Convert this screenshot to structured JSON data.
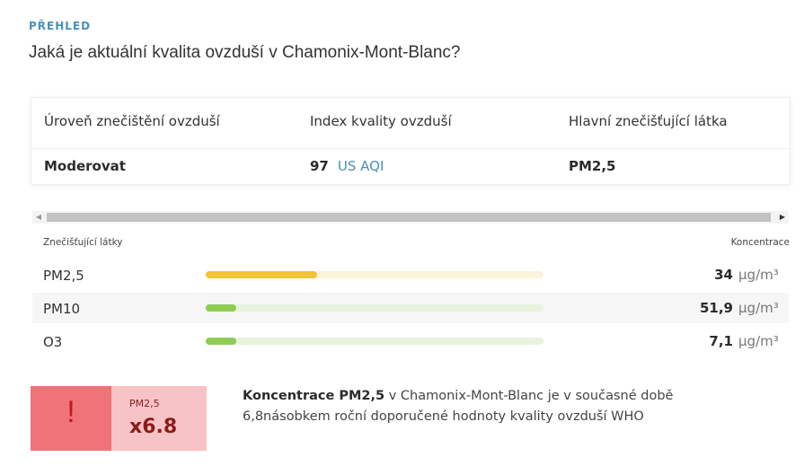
{
  "overview": {
    "section_label": "PŘEHLED",
    "question": "Jaká je aktuální kvalita ovzduší v Chamonix-Mont-Blanc?"
  },
  "summary": {
    "level_header": "Úroveň znečištění ovzduší",
    "level_value": "Moderovat",
    "aqi_header": "Index kvality ovzduší",
    "aqi_value": "97",
    "aqi_unit": "US AQI",
    "pollutant_header": "Hlavní znečišťující látka",
    "pollutant_value": "PM2,5"
  },
  "pollutants": {
    "header_left": "Znečišťující látky",
    "header_right": "Koncentrace",
    "rows": [
      {
        "name": "PM2,5",
        "value": "34",
        "unit": "µg/m³",
        "level": 0.33,
        "color": "#f2c335",
        "track": "#faf3d9"
      },
      {
        "name": "PM10",
        "value": "51,9",
        "unit": "µg/m³",
        "level": 0.09,
        "color": "#8fcc52",
        "track": "#e8f3dd"
      },
      {
        "name": "O3",
        "value": "7,1",
        "unit": "µg/m³",
        "level": 0.09,
        "color": "#8fcc52",
        "track": "#e8f3dd"
      }
    ]
  },
  "alert": {
    "icon": "exclamation-icon",
    "icon_glyph": "!",
    "label": "PM2,5",
    "multiplier": "x6.8",
    "text_bold": "Koncentrace PM2,5",
    "text_rest": " v Chamonix-Mont-Blanc je v současné době 6,8násobkem roční doporučené hodnoty kvality ovzduší WHO"
  }
}
